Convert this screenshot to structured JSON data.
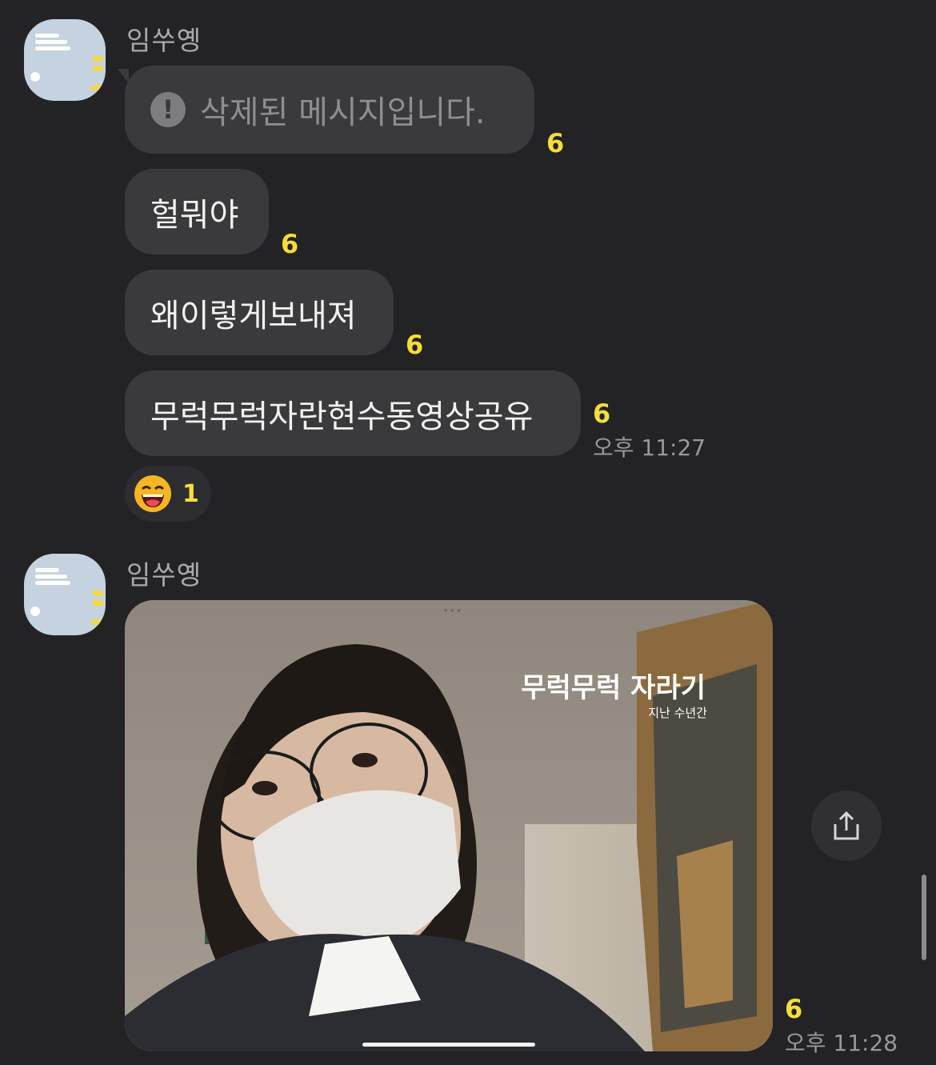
{
  "messages": [
    {
      "sender": "임쑤옝",
      "text": "삭제된 메시지입니다.",
      "unread": "6",
      "deleted": true
    },
    {
      "text": "헐뭐야",
      "unread": "6"
    },
    {
      "text": "왜이렇게보내져",
      "unread": "6"
    },
    {
      "text": "무럭무럭자란현수동영상공유",
      "unread": "6",
      "time": "오후 11:27"
    }
  ],
  "reaction": {
    "emoji": "grinning-face",
    "count": "1"
  },
  "video_message": {
    "sender": "임쑤옝",
    "title_overlay": "무럭무럭 자라기",
    "subtitle_overlay": "지난 수년간",
    "unread": "6",
    "time": "오후 11:28"
  },
  "icons": {
    "deleted": "exclamation-circle-icon",
    "share": "share-icon"
  },
  "colors": {
    "background": "#232325",
    "bubble": "#3a3a3c",
    "unread": "#f7dd38"
  }
}
